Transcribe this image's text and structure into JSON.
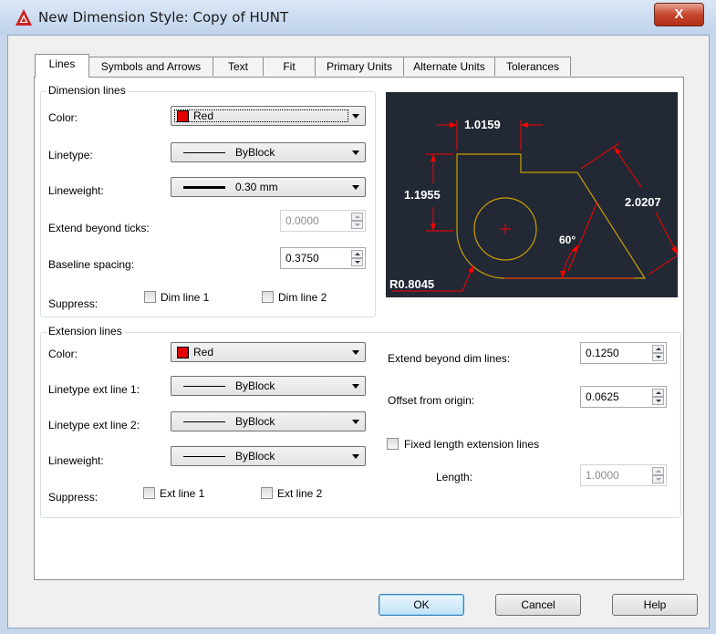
{
  "window": {
    "title": "New Dimension Style: Copy of HUNT",
    "close_label": "X"
  },
  "tabs": [
    {
      "label": "Lines",
      "active": true
    },
    {
      "label": "Symbols and Arrows",
      "active": false
    },
    {
      "label": "Text",
      "active": false
    },
    {
      "label": "Fit",
      "active": false
    },
    {
      "label": "Primary Units",
      "active": false
    },
    {
      "label": "Alternate Units",
      "active": false
    },
    {
      "label": "Tolerances",
      "active": false
    }
  ],
  "dimension_lines": {
    "title": "Dimension lines",
    "color_label": "Color:",
    "color_value": "Red",
    "color_hex": "#e00000",
    "linetype_label": "Linetype:",
    "linetype_value": "ByBlock",
    "lineweight_label": "Lineweight:",
    "lineweight_value": "0.30 mm",
    "extend_ticks_label": "Extend beyond ticks:",
    "extend_ticks_value": "0.0000",
    "baseline_label": "Baseline spacing:",
    "baseline_value": "0.3750",
    "suppress_label": "Suppress:",
    "dim_line1": "Dim line 1",
    "dim_line2": "Dim line 2"
  },
  "extension_lines": {
    "title": "Extension lines",
    "color_label": "Color:",
    "color_value": "Red",
    "linetype1_label": "Linetype ext line 1:",
    "linetype1_value": "ByBlock",
    "linetype2_label": "Linetype ext line 2:",
    "linetype2_value": "ByBlock",
    "lineweight_label": "Lineweight:",
    "lineweight_value": "ByBlock",
    "suppress_label": "Suppress:",
    "ext_line1": "Ext line 1",
    "ext_line2": "Ext line 2",
    "extend_dim_label": "Extend beyond dim lines:",
    "extend_dim_value": "0.1250",
    "offset_label": "Offset from origin:",
    "offset_value": "0.0625",
    "fixed_length_label": "Fixed length extension lines",
    "length_label": "Length:",
    "length_value": "1.0000"
  },
  "preview": {
    "dim_top": "1.0159",
    "dim_left": "1.1955",
    "dim_right": "2.0207",
    "angle": "60°",
    "radius": "R0.8045",
    "bg_color": "#222834",
    "geometry_color": "#c8a000",
    "dim_color": "#ff0000"
  },
  "buttons": {
    "ok": "OK",
    "cancel": "Cancel",
    "help": "Help"
  }
}
